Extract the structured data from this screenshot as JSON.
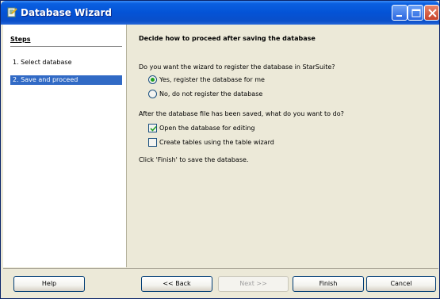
{
  "window": {
    "title": "Database Wizard",
    "accent_color": "#0453d6",
    "controls": [
      "minimize-icon",
      "maximize-icon",
      "close-icon"
    ]
  },
  "steps": {
    "title": "Steps",
    "items": [
      {
        "label": "1. Select database",
        "selected": false
      },
      {
        "label": "2. Save and proceed",
        "selected": true
      }
    ],
    "highlight_color": "#316ac5"
  },
  "page": {
    "heading": "Decide how to proceed after saving the database",
    "register_question": "Do you want the wizard to register the database in StarSuite?",
    "register_options": [
      {
        "label": "Yes, register the database for me",
        "selected": true
      },
      {
        "label": "No, do not register the database",
        "selected": false
      }
    ],
    "after_question": "After the database file has been saved, what do you want to do?",
    "after_options": [
      {
        "label": "Open the database for editing",
        "checked": true
      },
      {
        "label": "Create tables using the table wizard",
        "checked": false
      }
    ],
    "note": "Click 'Finish' to save the database."
  },
  "buttons": {
    "help": "Help",
    "back": "<< Back",
    "next": "Next >>",
    "next_enabled": false,
    "finish": "Finish",
    "cancel": "Cancel"
  }
}
